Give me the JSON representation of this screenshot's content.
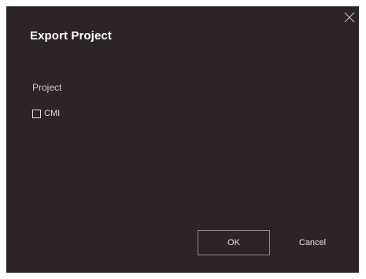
{
  "dialog": {
    "title": "Export Project",
    "close_icon": "close-icon",
    "section_label": "Project",
    "options": [
      {
        "label": "CMI",
        "checked": false
      }
    ],
    "buttons": {
      "ok_label": "OK",
      "cancel_label": "Cancel"
    }
  },
  "colors": {
    "background": "#2d2525",
    "text": "#e6e1e1",
    "button_border": "#8f8a8a"
  }
}
